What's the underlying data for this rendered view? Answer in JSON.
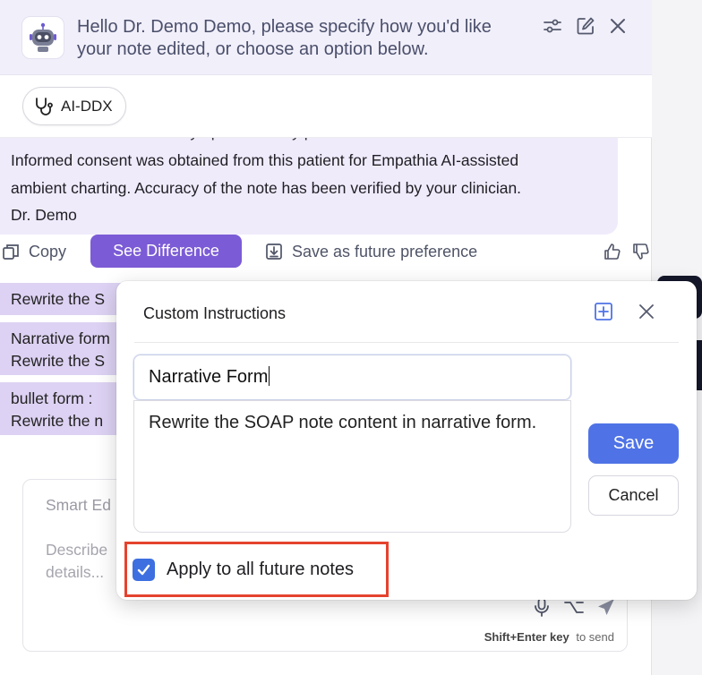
{
  "header": {
    "greeting": "Hello Dr. Demo Demo, please specify how you'd like your note edited, or choose an option below."
  },
  "chips": [
    {
      "label": "AI-DDX",
      "icon": "stethoscope-icon"
    }
  ],
  "message": {
    "cut_line": "- Further evaluate mood symptoms if they persist.",
    "lines": [
      "Informed consent was obtained from this patient for Empathia AI-assisted",
      "ambient charting. Accuracy of the note has been verified by your clinician.",
      "Dr. Demo"
    ]
  },
  "actions": {
    "copy": "Copy",
    "see_difference": "See Difference",
    "save_preference": "Save as future preference"
  },
  "suggestions": [
    {
      "lines": [
        "Rewrite the S"
      ]
    },
    {
      "lines": [
        "Narrative form",
        "Rewrite the S"
      ]
    },
    {
      "lines": [
        "bullet form :",
        "Rewrite the n"
      ]
    }
  ],
  "input": {
    "title": "Smart Ed",
    "placeholder": "Describe details...",
    "hint_key": "Shift+Enter key",
    "hint_text": "to send"
  },
  "modal": {
    "title": "Custom Instructions",
    "name_value": "Narrative Form",
    "instruction_text": "Rewrite the SOAP note content in narrative form.",
    "save_label": "Save",
    "cancel_label": "Cancel",
    "apply_label": "Apply to all future notes",
    "apply_checked": true
  },
  "colors": {
    "accent_purple": "#7b5bd6",
    "primary_blue": "#4f73e6",
    "highlight_red": "#e5432f"
  }
}
